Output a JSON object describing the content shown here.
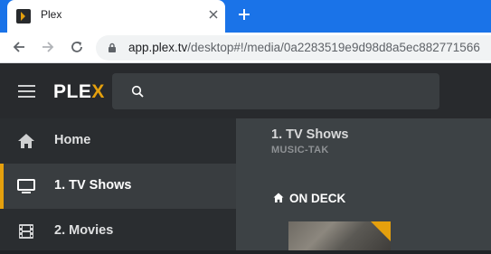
{
  "browser": {
    "tab_title": "Plex",
    "url_host": "app.plex.tv",
    "url_path": "/desktop#!/media/0a2283519e9d98d8a5ec882771566"
  },
  "header": {
    "logo_text": "PLE",
    "logo_accent": "X",
    "search_placeholder": ""
  },
  "sidebar": {
    "items": [
      {
        "label": "Home",
        "icon": "home-icon",
        "active": false
      },
      {
        "label": "1. TV Shows",
        "icon": "monitor-icon",
        "active": true
      },
      {
        "label": "2. Movies",
        "icon": "film-icon",
        "active": false
      }
    ]
  },
  "main": {
    "title": "1. TV Shows",
    "subtitle": "MUSIC-TAK",
    "section_title": "ON DECK"
  },
  "colors": {
    "accent": "#e5a00d",
    "tabstrip": "#1a73e8",
    "header_bg": "#282a2d",
    "sidebar_bg": "#2a2d30",
    "main_bg": "#3d4245"
  }
}
